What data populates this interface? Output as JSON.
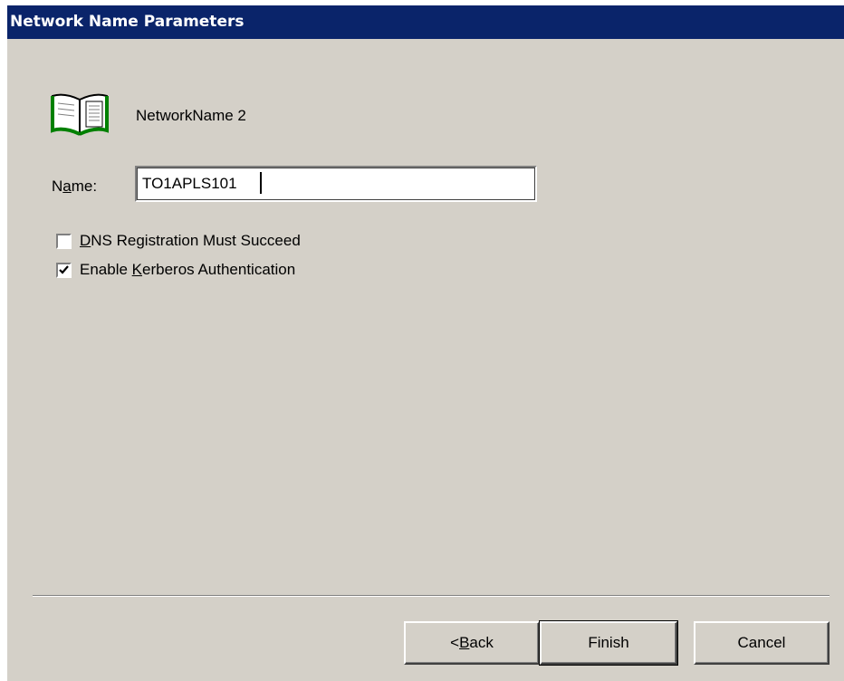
{
  "dialog": {
    "title": "Network Name Parameters"
  },
  "resource": {
    "icon": "open-book-icon",
    "name": "NetworkName 2"
  },
  "name_field": {
    "label_pre": "N",
    "label_accel": "a",
    "label_post": "me:",
    "value": "TO1APLS101"
  },
  "options": [
    {
      "pre": "",
      "accel": "D",
      "post": "NS Registration Must Succeed",
      "checked": false
    },
    {
      "pre": "Enable ",
      "accel": "K",
      "post": "erberos Authentication",
      "checked": true
    }
  ],
  "buttons": {
    "back": {
      "pre": "< ",
      "accel": "B",
      "post": "ack"
    },
    "finish": "Finish",
    "cancel": "Cancel"
  },
  "colors": {
    "titlebar": "#0a246a",
    "face": "#d4d0c8",
    "icon_green": "#008000"
  }
}
